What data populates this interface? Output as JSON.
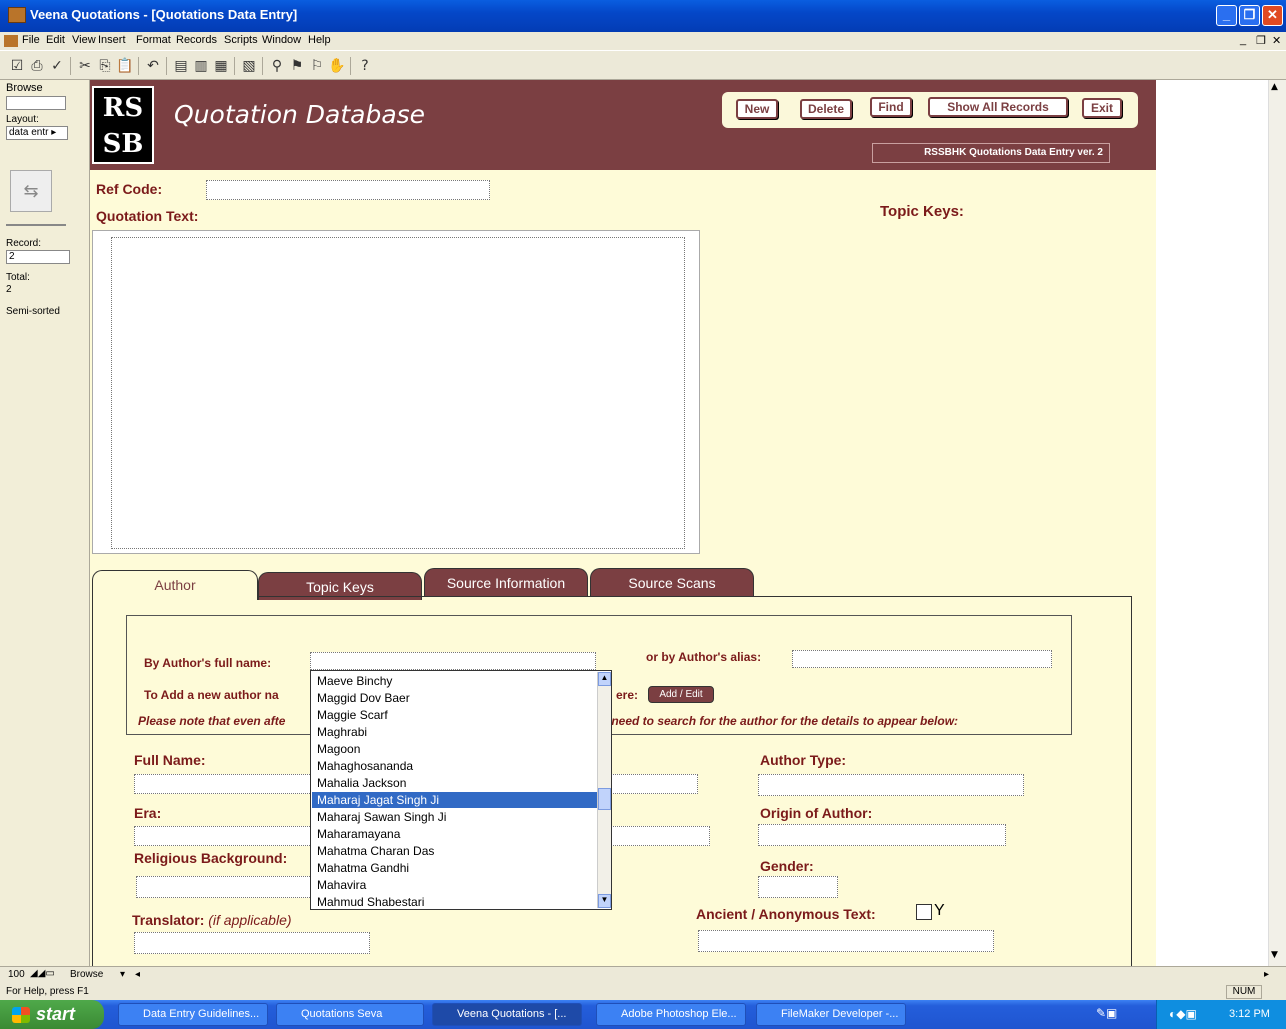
{
  "window": {
    "title": "Veena Quotations - [Quotations Data Entry]"
  },
  "menu": [
    "File",
    "Edit",
    "View",
    "Insert",
    "Format",
    "Records",
    "Scripts",
    "Window",
    "Help"
  ],
  "status_pane": {
    "mode": "Browse",
    "layout_label": "Layout:",
    "layout_value": "data entr",
    "record_label": "Record:",
    "record_value": "2",
    "total_label": "Total:",
    "total_value": "2",
    "sort_state": "Semi-sorted"
  },
  "header": {
    "logo_line1": "RS",
    "logo_line2": "SB",
    "title": "Quotation Database",
    "version": "RSSBHK Quotations Data Entry ver. 2",
    "buttons": {
      "new": "New",
      "delete": "Delete",
      "find": "Find",
      "show_all": "Show All Records",
      "exit": "Exit"
    }
  },
  "form": {
    "ref_code_label": "Ref Code:",
    "quotation_text_label": "Quotation Text:",
    "topic_keys_label": "Topic Keys:"
  },
  "tabs": [
    "Author",
    "Topic Keys",
    "Source Information",
    "Source Scans"
  ],
  "author": {
    "full_name_search_label": "By Author's full name:",
    "alias_label": "or by Author's alias:",
    "add_new_label_a": "To Add a new author na",
    "add_new_label_b": "ere:",
    "add_edit_button": "Add / Edit",
    "note_a": "Please note that even afte",
    "note_b": "ill need to search for the author for the details to appear below:",
    "full_name_label": "Full Name:",
    "author_type_label": "Author Type:",
    "era_label": "Era:",
    "origin_label": "Origin of Author:",
    "religious_label": "Religious Background:",
    "gender_label": "Gender:",
    "translator_label": "Translator:",
    "translator_hint": "(if applicable)",
    "ancient_label": "Ancient / Anonymous Text:",
    "ancient_check": "Y"
  },
  "dropdown": {
    "items": [
      "Maeve Binchy",
      "Maggid Dov Baer",
      "Maggie Scarf",
      "Maghrabi",
      "Magoon",
      "Mahaghosananda",
      "Mahalia Jackson",
      "Maharaj Jagat Singh Ji",
      "Maharaj Sawan Singh Ji",
      "Maharamayana",
      "Mahatma Charan Das",
      "Mahatma Gandhi",
      "Mahavira",
      "Mahmud Shabestari"
    ],
    "selected": "Maharaj Jagat Singh Ji"
  },
  "bottom": {
    "zoom": "100",
    "mode": "Browse",
    "help": "For Help, press F1",
    "num": "NUM"
  },
  "taskbar": {
    "start": "start",
    "tasks": [
      "Data Entry Guidelines...",
      "Quotations Seva",
      "Veena Quotations - [...",
      "Adobe Photoshop Ele...",
      "FileMaker Developer -..."
    ],
    "time": "3:12 PM"
  },
  "colors": {
    "brand": "#7b3f42",
    "form_bg": "#fefbd8",
    "label": "#7b1a1a",
    "selection": "#316ac5"
  }
}
